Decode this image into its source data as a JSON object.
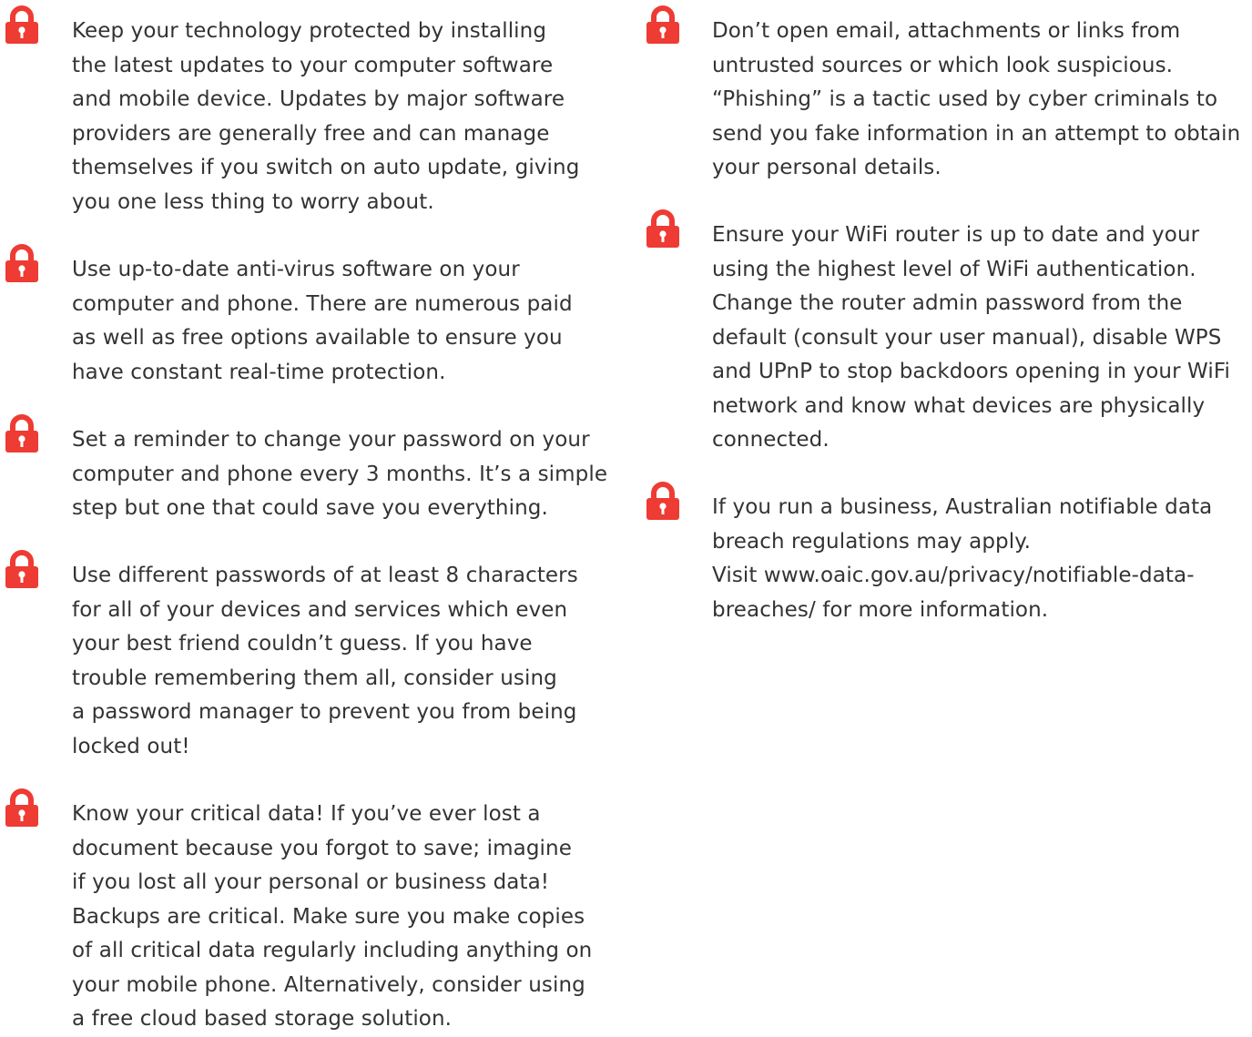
{
  "theme": {
    "accent": "#ee3b33",
    "text": "#333333",
    "background": "#ffffff"
  },
  "left_column": {
    "tips": [
      {
        "icon": "padlock-icon",
        "text": "Keep your technology protected by installing\nthe latest updates to your computer software\nand mobile device. Updates by major software\nproviders are generally free and can manage\nthemselves if you switch on auto update, giving\nyou one less thing to worry about."
      },
      {
        "icon": "padlock-icon",
        "text": "Use up-to-date anti-virus software on your\ncomputer and phone. There are numerous paid\nas well as free options available to ensure you\nhave constant real-time protection."
      },
      {
        "icon": "padlock-icon",
        "text": "Set a reminder to change your password on your\ncomputer and phone every 3 months. It’s a simple\nstep but one that could save you everything."
      },
      {
        "icon": "padlock-icon",
        "text": "Use different passwords of at least 8 characters\nfor all of your devices and services which even\nyour best friend couldn’t guess. If you have\ntrouble remembering them all, consider using\na password manager to prevent you from being\nlocked out!"
      },
      {
        "icon": "padlock-icon",
        "text": "Know your critical data! If you’ve ever lost a\ndocument because you forgot to save; imagine\nif you lost all your personal or business data!\nBackups are critical. Make sure you make copies\nof all critical data regularly including anything on\nyour mobile phone. Alternatively, consider using\na free cloud based storage solution."
      }
    ]
  },
  "right_column": {
    "tips": [
      {
        "icon": "padlock-icon",
        "text": "Don’t open email, attachments or links from\nuntrusted sources or which look suspicious.\n“Phishing” is a tactic used by cyber criminals to\nsend you fake information in an attempt to obtain\nyour personal details."
      },
      {
        "icon": "padlock-icon",
        "text": "Ensure your WiFi router is up to date and your\nusing the highest level of WiFi authentication.\nChange the router admin password from the\ndefault (consult your user manual), disable WPS\nand UPnP to stop backdoors opening in your WiFi\nnetwork and know what devices are physically\nconnected."
      },
      {
        "icon": "padlock-icon",
        "text": "If you run a business, Australian notifiable data\nbreach regulations may apply.\nVisit www.oaic.gov.au/privacy/notifiable-data-\nbreaches/ for more information."
      }
    ]
  }
}
